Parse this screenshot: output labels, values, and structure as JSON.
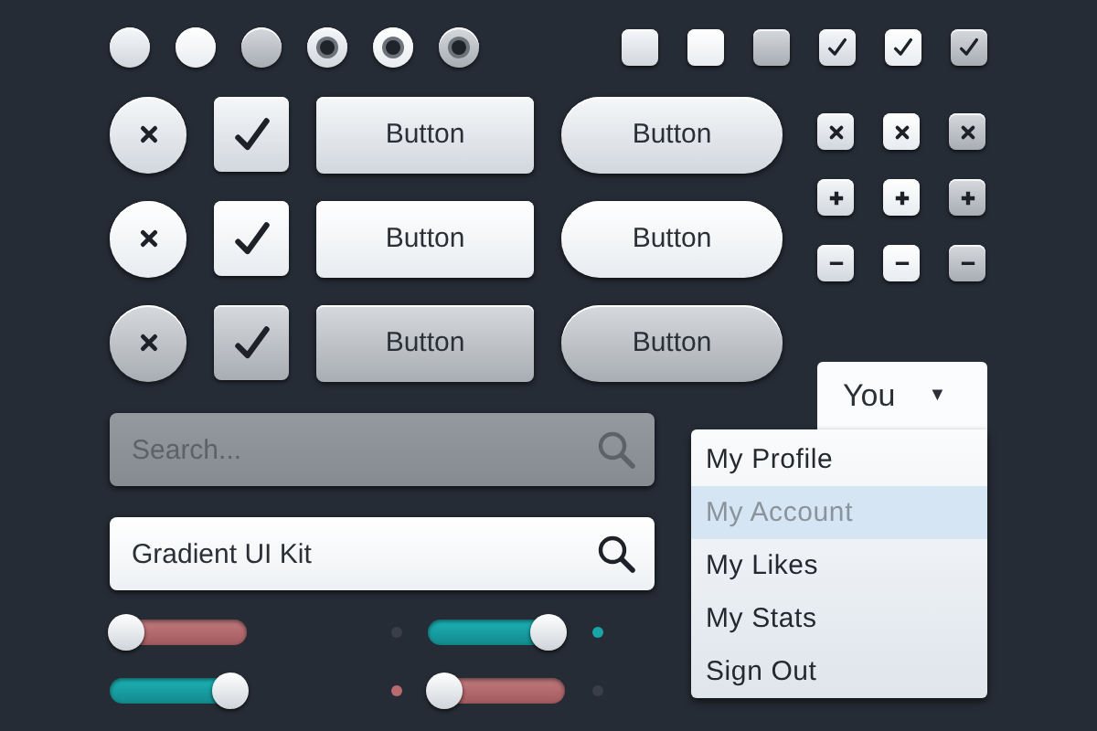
{
  "radios": [
    {
      "selected": false,
      "kind": "normal"
    },
    {
      "selected": false,
      "kind": "hover"
    },
    {
      "selected": false,
      "kind": "pressed"
    },
    {
      "selected": true,
      "kind": "normal"
    },
    {
      "selected": true,
      "kind": "hover"
    },
    {
      "selected": true,
      "kind": "pressed"
    }
  ],
  "checkboxes": [
    {
      "checked": false,
      "kind": "normal"
    },
    {
      "checked": false,
      "kind": "hover"
    },
    {
      "checked": false,
      "kind": "pressed"
    },
    {
      "checked": true,
      "kind": "normal"
    },
    {
      "checked": true,
      "kind": "hover"
    },
    {
      "checked": true,
      "kind": "pressed"
    }
  ],
  "button_rows": [
    {
      "kind": "normal",
      "checked": true,
      "button_label": "Button",
      "pill_label": "Button"
    },
    {
      "kind": "hover",
      "checked": true,
      "button_label": "Button",
      "pill_label": "Button"
    },
    {
      "kind": "pressed",
      "checked": true,
      "button_label": "Button",
      "pill_label": "Button"
    }
  ],
  "icon_rows": [
    {
      "kind": "close",
      "cells": [
        {
          "kind": "normal"
        },
        {
          "kind": "hover"
        },
        {
          "kind": "pressed"
        }
      ]
    },
    {
      "kind": "plus",
      "cells": [
        {
          "kind": "normal"
        },
        {
          "kind": "hover"
        },
        {
          "kind": "pressed"
        }
      ]
    },
    {
      "kind": "minus",
      "cells": [
        {
          "kind": "normal"
        },
        {
          "kind": "hover"
        },
        {
          "kind": "pressed"
        }
      ]
    }
  ],
  "search_fields": [
    {
      "placeholder": "Search...",
      "disabled": true
    },
    {
      "value": "Gradient UI Kit",
      "disabled": false
    }
  ],
  "toggles": [
    {
      "on": false,
      "color": "#3a3f47"
    },
    {
      "on": true,
      "color": "#19a5a8"
    },
    {
      "on": true,
      "color": "#b86a6e"
    },
    {
      "on": false,
      "color": "#3a3f47"
    }
  ],
  "dropdown": {
    "label": "You",
    "caret": "▼",
    "items": [
      {
        "label": "My Profile",
        "selected": false
      },
      {
        "label": "My Account",
        "selected": true
      },
      {
        "label": "My Likes",
        "selected": false
      },
      {
        "label": "My Stats",
        "selected": false
      },
      {
        "label": "Sign Out",
        "selected": false
      }
    ]
  }
}
